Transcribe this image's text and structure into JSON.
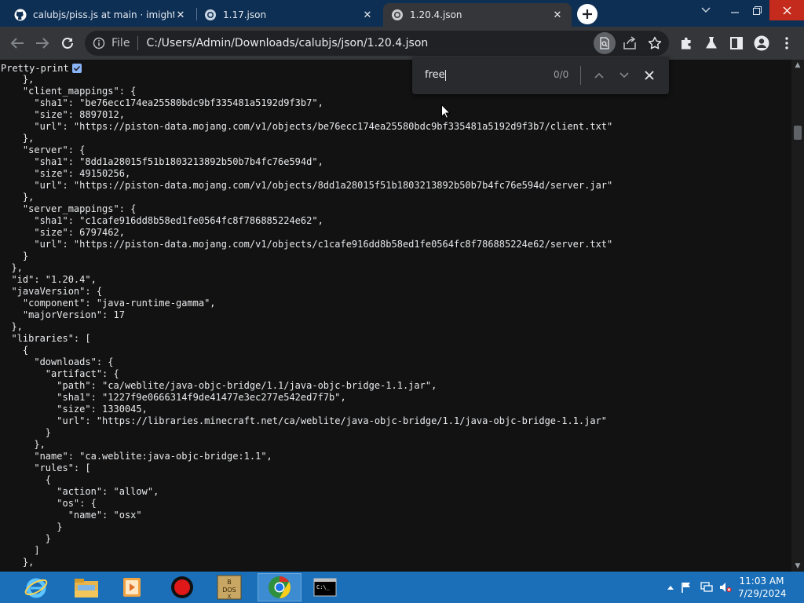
{
  "tabs": [
    {
      "title": "calubjs/piss.js at main · imightex",
      "favicon": "github-icon",
      "active": false
    },
    {
      "title": "1.17.json",
      "favicon": "globe-icon",
      "active": false
    },
    {
      "title": "1.20.4.json",
      "favicon": "globe-icon",
      "active": true
    }
  ],
  "toolbar": {
    "scheme_label": "File",
    "url": "C:/Users/Admin/Downloads/calubjs/json/1.20.4.json"
  },
  "pretty_print": {
    "label": "Pretty-print",
    "checked": true
  },
  "find": {
    "query": "free",
    "count": "0/0"
  },
  "json_lines": [
    "  },",
    "  \"client_mappings\": {",
    "    \"sha1\": \"be76ecc174ea25580bdc9bf335481a5192d9f3b7\",",
    "    \"size\": 8897012,",
    "    \"url\": \"https://piston-data.mojang.com/v1/objects/be76ecc174ea25580bdc9bf335481a5192d9f3b7/client.txt\"",
    "  },",
    "  \"server\": {",
    "    \"sha1\": \"8dd1a28015f51b1803213892b50b7b4fc76e594d\",",
    "    \"size\": 49150256,",
    "    \"url\": \"https://piston-data.mojang.com/v1/objects/8dd1a28015f51b1803213892b50b7b4fc76e594d/server.jar\"",
    "  },",
    "  \"server_mappings\": {",
    "    \"sha1\": \"c1cafe916dd8b58ed1fe0564fc8f786885224e62\",",
    "    \"size\": 6797462,",
    "    \"url\": \"https://piston-data.mojang.com/v1/objects/c1cafe916dd8b58ed1fe0564fc8f786885224e62/server.txt\"",
    "  }",
    "},",
    "\"id\": \"1.20.4\",",
    "\"javaVersion\": {",
    "  \"component\": \"java-runtime-gamma\",",
    "  \"majorVersion\": 17",
    "},",
    "\"libraries\": [",
    "  {",
    "    \"downloads\": {",
    "      \"artifact\": {",
    "        \"path\": \"ca/weblite/java-objc-bridge/1.1/java-objc-bridge-1.1.jar\",",
    "        \"sha1\": \"1227f9e0666314f9de41477e3ec277e542ed7f7b\",",
    "        \"size\": 1330045,",
    "        \"url\": \"https://libraries.minecraft.net/ca/weblite/java-objc-bridge/1.1/java-objc-bridge-1.1.jar\"",
    "      }",
    "    },",
    "    \"name\": \"ca.weblite:java-objc-bridge:1.1\",",
    "    \"rules\": [",
    "      {",
    "        \"action\": \"allow\",",
    "        \"os\": {",
    "          \"name\": \"osx\"",
    "        }",
    "      }",
    "    ]",
    "  },"
  ],
  "taskbar": {
    "apps": [
      "internet-explorer-icon",
      "file-explorer-icon",
      "media-player-icon",
      "record-icon",
      "dosbox-icon",
      "chrome-icon",
      "cmd-icon"
    ],
    "time": "11:03 AM",
    "date": "7/29/2024"
  }
}
